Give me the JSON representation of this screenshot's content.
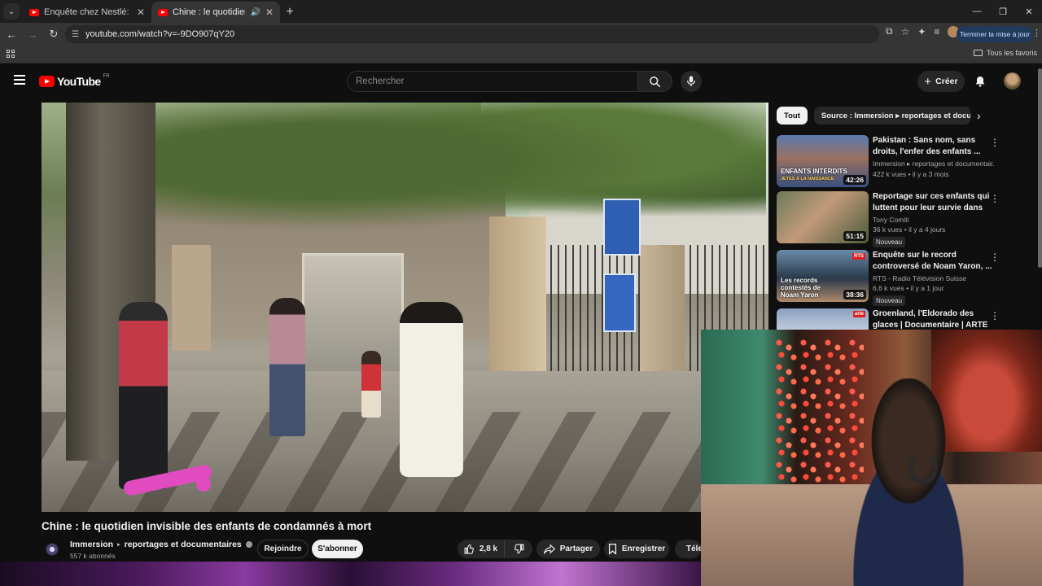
{
  "browser": {
    "tabs": [
      {
        "title": "Enquête chez Nestlé: le scandale",
        "active": false
      },
      {
        "title": "Chine : le quotidien invisible",
        "active": true
      }
    ],
    "url": "youtube.com/watch?v=-9DO907qY20",
    "update_button": "Terminer la mise à jour",
    "bookmarks_all": "Tous les favoris"
  },
  "youtube": {
    "logo_text": "YouTube",
    "region": "FR",
    "search_placeholder": "Rechercher",
    "create_label": "Créer"
  },
  "video": {
    "title": "Chine : le quotidien invisible des enfants de condamnés à mort",
    "channel": "Immersion",
    "channel_suffix": "reportages et documentaires",
    "subscribers": "557 k abonnés",
    "join_label": "Rejoindre",
    "subscribe_label": "S'abonner",
    "likes": "2,8 k",
    "share_label": "Partager",
    "save_label": "Enregistrer",
    "download_label": "Télécharger"
  },
  "sidebar": {
    "chips": [
      "Tout",
      "Source : Immersion ▸ reportages et documentaires"
    ],
    "recommendations": [
      {
        "title": "Pakistan : Sans nom, sans droits, l'enfer des enfants ...",
        "channel": "Immersion ▸ reportages et documentair...",
        "stats": "422 k vues • il y a 3 mois",
        "duration": "42:26",
        "thumb_text": "ENFANTS INTERDITS",
        "thumb_subtext": "JETÉS À LA NAISSANCE",
        "badge": ""
      },
      {
        "title": "Reportage sur ces enfants qui luttent pour leur survie dans le...",
        "channel": "Tony Comiti",
        "stats": "36 k vues • il y a 4 jours",
        "duration": "51:15",
        "badge": "Nouveau"
      },
      {
        "title": "Enquête sur le record controversé de Noam Yaron, ...",
        "channel": "RTS - Radio Télévision Suisse",
        "stats": "6,6 k vues • il y a 1 jour",
        "duration": "38:36",
        "thumb_text": "Les records contestés de Noam Yaron",
        "thumb_tag": "RTS",
        "badge": "Nouveau"
      },
      {
        "title": "Groenland, l'Eldorado des glaces | Documentaire | ARTE",
        "channel": "",
        "stats": "",
        "duration": "",
        "thumb_tag": "arte",
        "badge": ""
      }
    ]
  },
  "colors": {
    "background": "#0f0f0f",
    "youtube_red": "#ff0000",
    "chip_bg": "#272727"
  }
}
